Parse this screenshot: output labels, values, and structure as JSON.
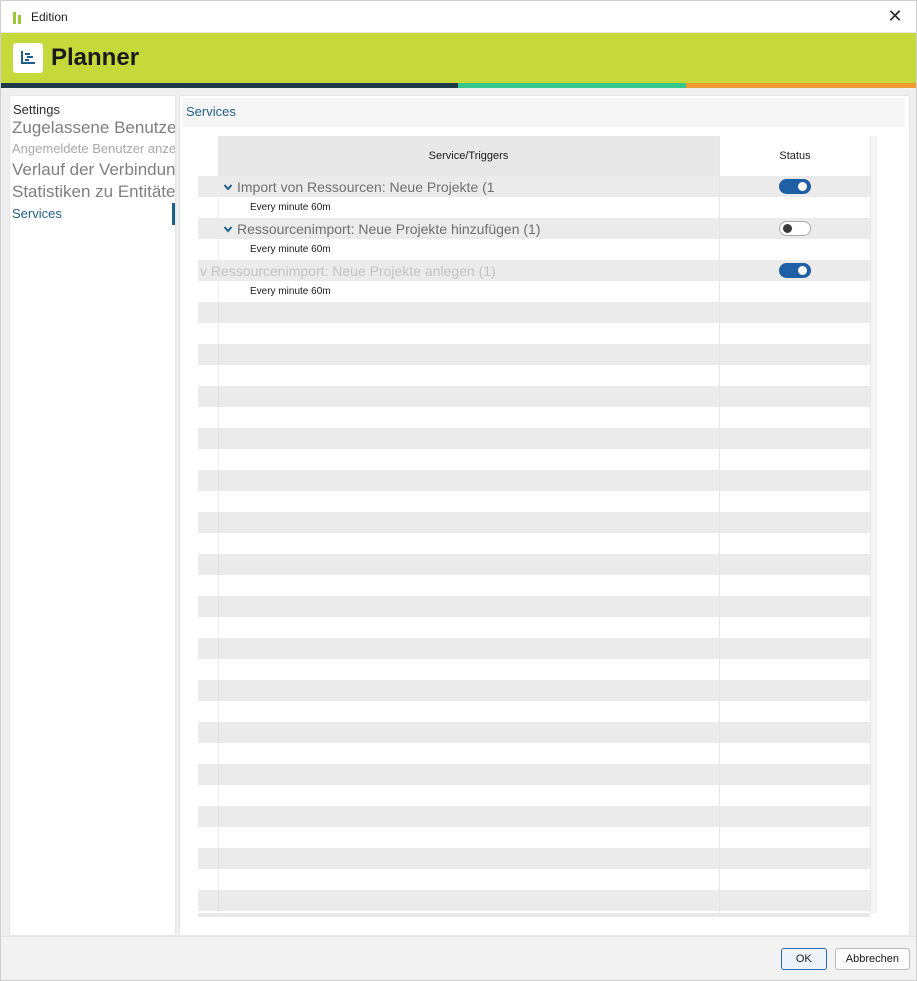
{
  "window": {
    "title": "Edition",
    "close_glyph": "✕"
  },
  "header": {
    "product": "Planner",
    "accent": "#c5da3a",
    "stripe_colors": [
      "#1f3a48",
      "#38c78a",
      "#f19a33"
    ]
  },
  "sidebar": {
    "settings_label": "Settings",
    "items": [
      {
        "label": "Zugelassene Benutzer/Gruppen",
        "style": "big"
      },
      {
        "label": "Angemeldete Benutzer anzeigen",
        "style": "small"
      },
      {
        "label": "Verlauf der Verbindung",
        "style": "big"
      },
      {
        "label": "Statistiken zu Entitäten",
        "style": "big"
      },
      {
        "label": "Services",
        "style": "active"
      }
    ]
  },
  "main": {
    "breadcrumb": "Services",
    "table": {
      "columns": [
        "Service/Triggers",
        "Status"
      ],
      "groups": [
        {
          "title": "Import von Ressourcen: Neue Projekte (1",
          "chevron": "chevron-down-icon",
          "status": "on",
          "trigger": "Every minute 60m",
          "faded": false
        },
        {
          "title": "Ressourcenimport: Neue Projekte hinzufügen (1)",
          "chevron": "chevron-down-icon",
          "status": "off",
          "trigger": "Every minute 60m",
          "faded": false
        },
        {
          "title": "v Ressourcenimport: Neue Projekte anlegen (1)",
          "chevron": "",
          "status": "on",
          "trigger": "Every minute 60m",
          "faded": true
        }
      ]
    }
  },
  "footer": {
    "ok_label": "OK",
    "cancel_label": "Abbrechen"
  },
  "colors": {
    "link_blue": "#1f5f8b",
    "toggle_on": "#1f5fa6"
  }
}
